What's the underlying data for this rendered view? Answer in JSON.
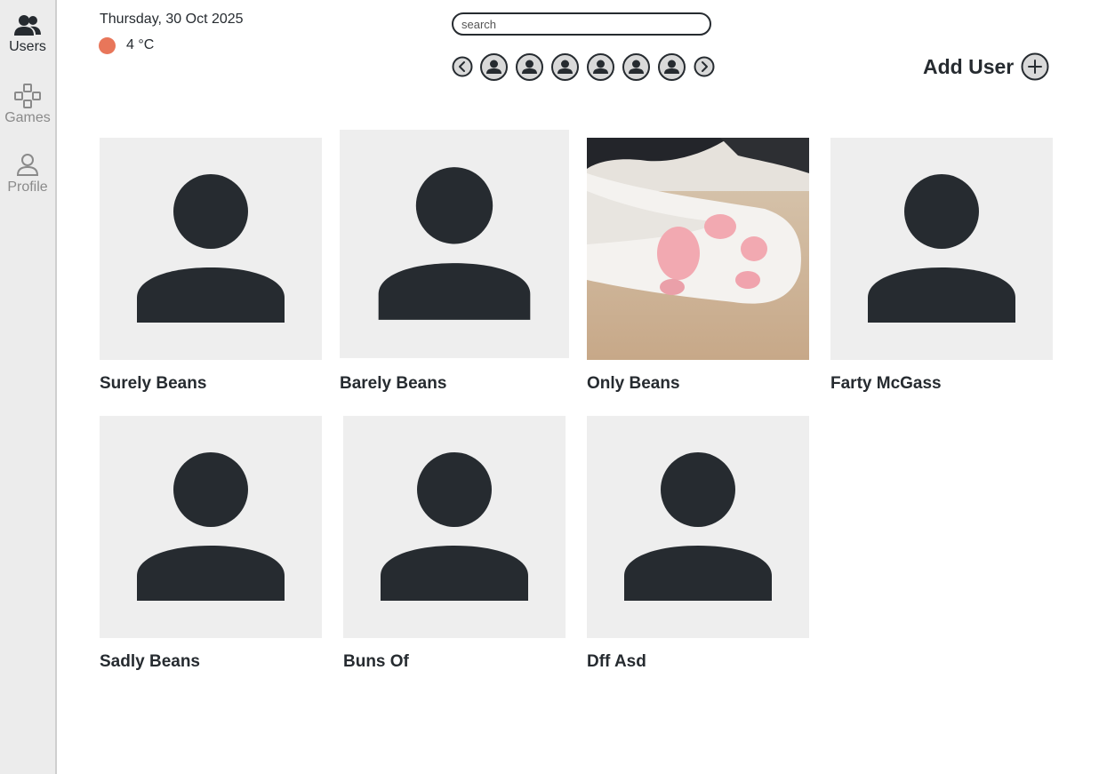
{
  "sidebar": {
    "items": [
      {
        "label": "Users",
        "icon": "users-icon",
        "active": true
      },
      {
        "label": "Games",
        "icon": "gamepad-icon",
        "active": false
      },
      {
        "label": "Profile",
        "icon": "person-icon",
        "active": false
      }
    ]
  },
  "header": {
    "date": "Thursday, 30 Oct 2025",
    "weather": {
      "temperature": "4 °C",
      "indicator_color": "#e8765a",
      "icon": "weather-dot-icon"
    }
  },
  "search": {
    "placeholder": "search",
    "value": ""
  },
  "carousel": {
    "prev_icon": "chevron-left-icon",
    "next_icon": "chevron-right-icon",
    "avatar_count": 6,
    "avatar_icon": "user-avatar-icon"
  },
  "add_user": {
    "label": "Add User",
    "icon": "plus-circle-icon"
  },
  "users": [
    {
      "name": "Surely Beans",
      "image": "default-avatar"
    },
    {
      "name": "Barely Beans",
      "image": "default-avatar"
    },
    {
      "name": "Only Beans",
      "image": "cat-paw-photo"
    },
    {
      "name": "Farty McGass",
      "image": "default-avatar"
    },
    {
      "name": "Sadly Beans",
      "image": "default-avatar"
    },
    {
      "name": "Buns Of",
      "image": "default-avatar"
    },
    {
      "name": "Dff Asd",
      "image": "default-avatar"
    }
  ],
  "colors": {
    "text": "#262b30",
    "card_bg": "#eeeeee",
    "sidebar_bg": "#ececec",
    "inactive_nav": "#8a8a8a"
  }
}
